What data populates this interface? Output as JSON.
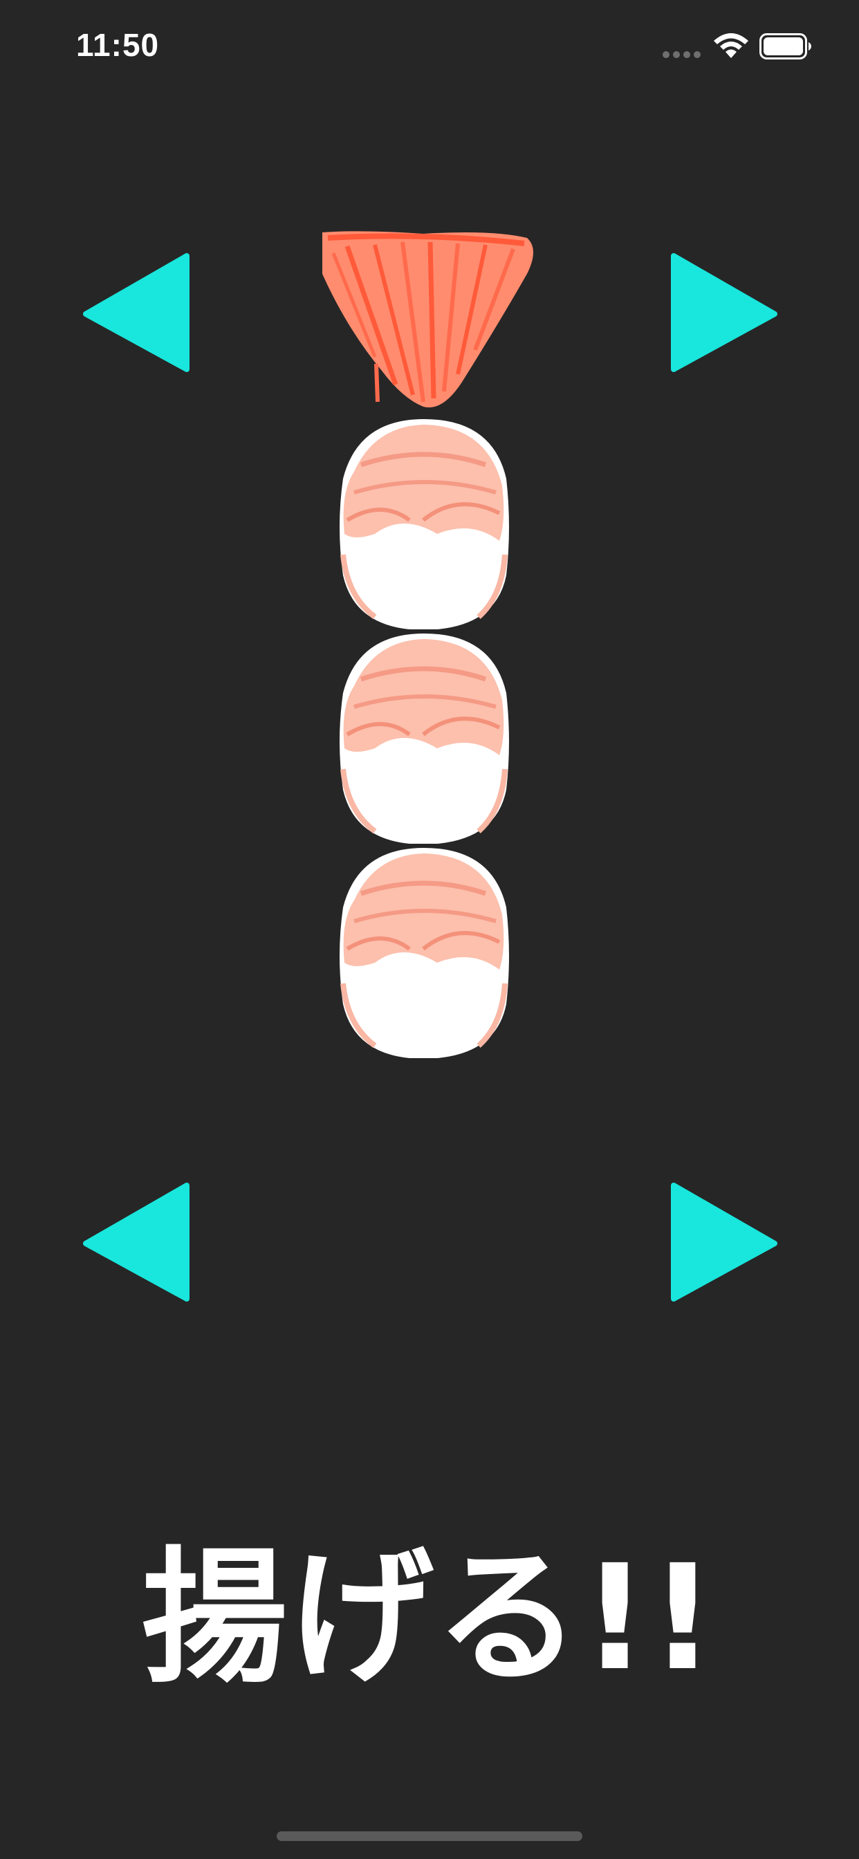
{
  "status_bar": {
    "time": "11:50",
    "signal_icon": "cellular-signal-icon",
    "wifi_icon": "wifi-icon",
    "battery_icon": "battery-icon"
  },
  "controls": {
    "top_left": "left-arrow-icon",
    "top_right": "right-arrow-icon",
    "bottom_left": "left-arrow-icon",
    "bottom_right": "right-arrow-icon",
    "arrow_color": "#19e6dc"
  },
  "shrimp_stack": {
    "tail_icon": "shrimp-tail-icon",
    "segment_icon": "shrimp-segment-icon",
    "segments": 3
  },
  "action": {
    "fry_label": "揚げる!!"
  },
  "colors": {
    "background": "#262626",
    "text": "#ffffff",
    "shrimp_red": "#ff6a4d",
    "shrimp_pink": "#f9b7a4"
  }
}
